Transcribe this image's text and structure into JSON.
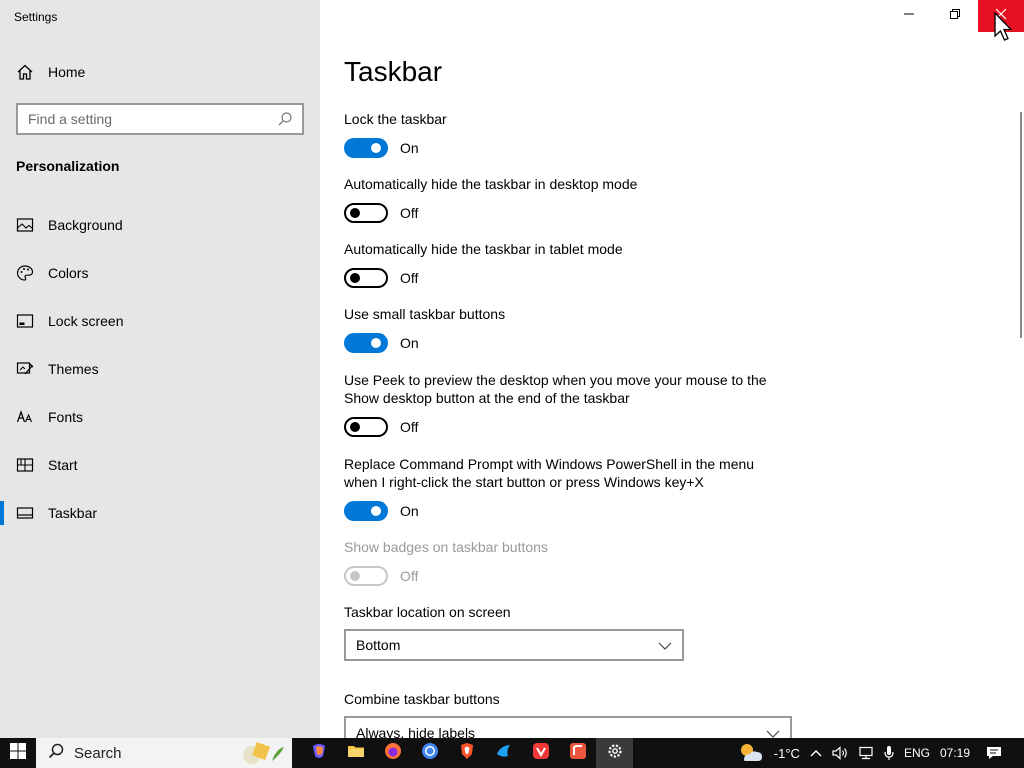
{
  "window": {
    "app_title": "Settings"
  },
  "sidebar": {
    "home_label": "Home",
    "search_placeholder": "Find a setting",
    "section_title": "Personalization",
    "items": [
      {
        "label": "Background",
        "icon": "picture-icon"
      },
      {
        "label": "Colors",
        "icon": "palette-icon"
      },
      {
        "label": "Lock screen",
        "icon": "lock-screen-icon"
      },
      {
        "label": "Themes",
        "icon": "themes-icon"
      },
      {
        "label": "Fonts",
        "icon": "fonts-icon"
      },
      {
        "label": "Start",
        "icon": "start-icon"
      },
      {
        "label": "Taskbar",
        "icon": "taskbar-icon",
        "active": true
      }
    ]
  },
  "main": {
    "title": "Taskbar",
    "settings": [
      {
        "label": "Lock the taskbar",
        "state": "On"
      },
      {
        "label": "Automatically hide the taskbar in desktop mode",
        "state": "Off"
      },
      {
        "label": "Automatically hide the taskbar in tablet mode",
        "state": "Off"
      },
      {
        "label": "Use small taskbar buttons",
        "state": "On"
      },
      {
        "label": "Use Peek to preview the desktop when you move your mouse to the Show desktop button at the end of the taskbar",
        "state": "Off"
      },
      {
        "label": "Replace Command Prompt with Windows PowerShell in the menu when I right-click the start button or press Windows key+X",
        "state": "On"
      },
      {
        "label": "Show badges on taskbar buttons",
        "state": "Off",
        "disabled": true
      }
    ],
    "location_label": "Taskbar location on screen",
    "location_value": "Bottom",
    "combine_label": "Combine taskbar buttons",
    "combine_value": "Always, hide labels"
  },
  "taskbar": {
    "search_label": "Search",
    "apps": [
      "copilot",
      "file-explorer",
      "firefox",
      "chrome",
      "brave",
      "app-blue",
      "vivaldi",
      "app-orange",
      "settings"
    ],
    "tray": {
      "temperature": "-1°C",
      "language": "ENG",
      "time": "07:19"
    }
  },
  "colors": {
    "accent": "#0078d7",
    "close": "#e81123",
    "sidebar": "#e6e6e6"
  }
}
